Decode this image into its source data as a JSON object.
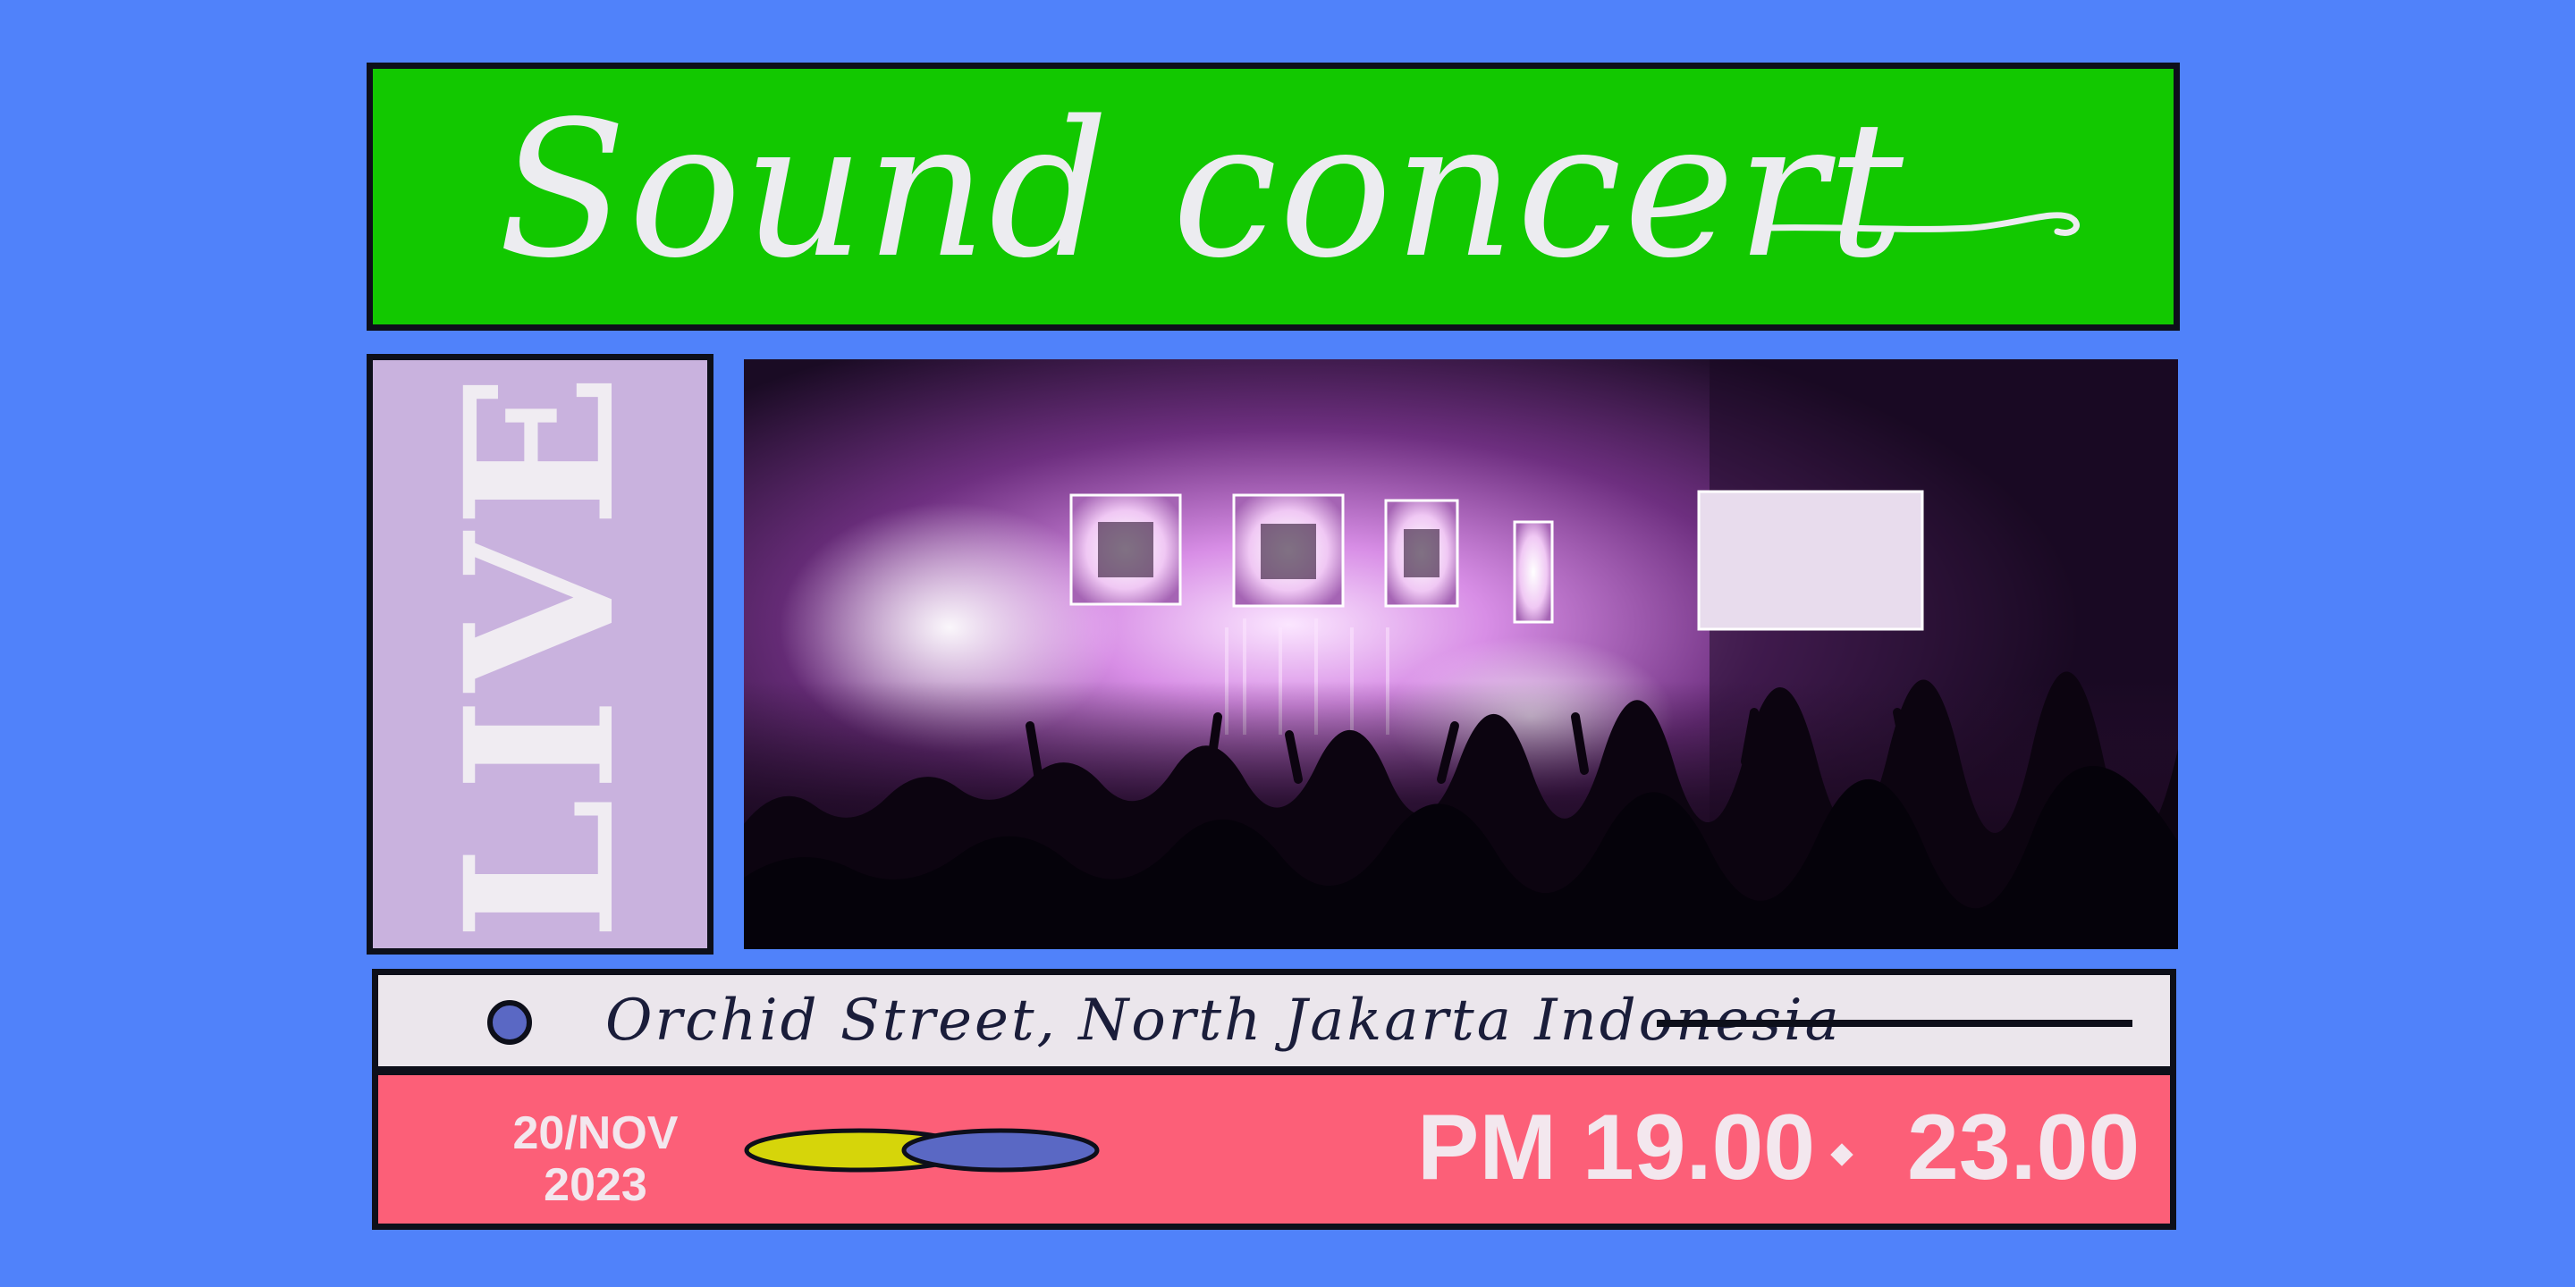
{
  "title": "Sound concert",
  "live_label": "LIVE",
  "photo": {
    "description_icon": "concert-crowd-photo"
  },
  "venue": {
    "address": "Orchid Street, North Jakarta Indonesia"
  },
  "schedule": {
    "date_line1": "20/NOV",
    "date_line2": "2023",
    "time_start": "PM 19.00",
    "time_end": "23.00"
  },
  "colors": {
    "background": "#5082fa",
    "title_banner": "#12c800",
    "live_panel": "#c9b2de",
    "address_bar": "#ebe6ec",
    "date_bar": "#fc5f78",
    "pill_yellow": "#d6d50a",
    "pill_blue": "#5a68c4",
    "outline": "#0d0f1a"
  }
}
